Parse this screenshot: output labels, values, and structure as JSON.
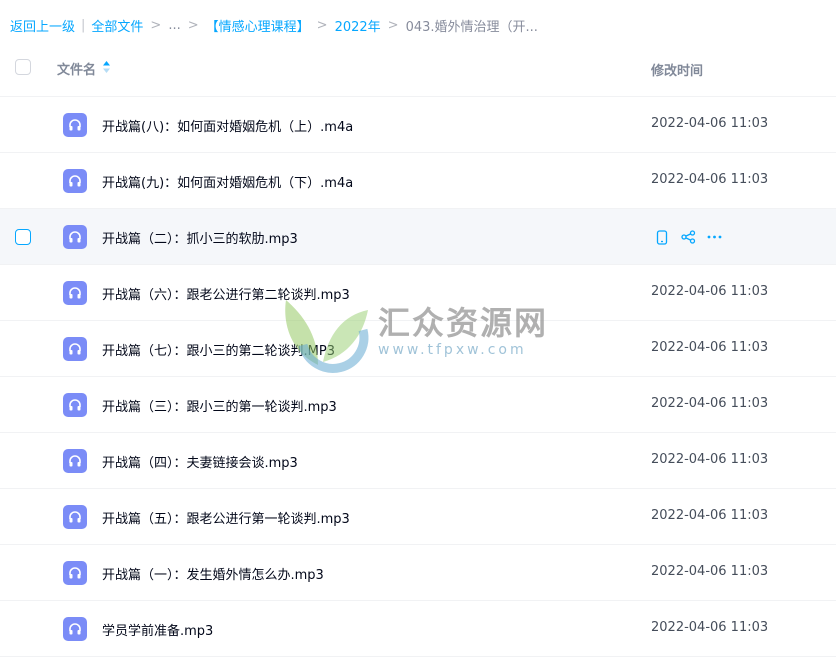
{
  "breadcrumb": {
    "back": "返回上一级",
    "all_files": "全部文件",
    "ellipsis": "...",
    "crumb1": "【情感心理课程】",
    "crumb2": "2022年",
    "current": "043.婚外情治理（开..."
  },
  "header": {
    "name_col": "文件名",
    "time_col": "修改时间"
  },
  "files": [
    {
      "name": "开战篇(八)：如何面对婚姻危机（上）.m4a",
      "time": "2022-04-06 11:03"
    },
    {
      "name": "开战篇(九)：如何面对婚姻危机（下）.m4a",
      "time": "2022-04-06 11:03"
    },
    {
      "name": "开战篇（二）：抓小三的软肋.mp3",
      "time": ""
    },
    {
      "name": "开战篇（六）：跟老公进行第二轮谈判.mp3",
      "time": "2022-04-06 11:03"
    },
    {
      "name": "开战篇（七）：跟小三的第二轮谈判.MP3",
      "time": "2022-04-06 11:03"
    },
    {
      "name": "开战篇（三）：跟小三的第一轮谈判.mp3",
      "time": "2022-04-06 11:03"
    },
    {
      "name": "开战篇（四）：夫妻链接会谈.mp3",
      "time": "2022-04-06 11:03"
    },
    {
      "name": "开战篇（五）：跟老公进行第一轮谈判.mp3",
      "time": "2022-04-06 11:03"
    },
    {
      "name": "开战篇（一）：发生婚外情怎么办.mp3",
      "time": "2022-04-06 11:03"
    },
    {
      "name": "学员学前准备.mp3",
      "time": "2022-04-06 11:03"
    }
  ],
  "watermark": {
    "title": "汇众资源网",
    "url": "www.tfpxw.com"
  },
  "colors": {
    "link": "#06a7ff",
    "file_icon": "#7b8cf7",
    "hover_row": "#f5f7fa"
  },
  "icons": {
    "file": "headphones-icon",
    "sort": "sort-icon",
    "phone": "phone-icon",
    "share": "share-icon",
    "more": "more-icon"
  }
}
